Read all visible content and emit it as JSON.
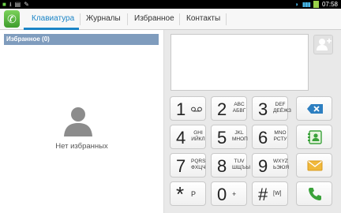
{
  "status_bar": {
    "time": "07:58"
  },
  "tabs": [
    {
      "label": "Клавиатура",
      "active": true
    },
    {
      "label": "Журналы",
      "active": false
    },
    {
      "label": "Избранное",
      "active": false
    },
    {
      "label": "Контакты",
      "active": false
    }
  ],
  "favorites": {
    "header": "Избранное (0)",
    "empty_text": "Нет избранных"
  },
  "keypad": {
    "keys": [
      {
        "digit": "1",
        "letters": "",
        "symbol": "voicemail"
      },
      {
        "digit": "2",
        "letters": "ABC\nАБВГ"
      },
      {
        "digit": "3",
        "letters": "DEF\nДЕЁЖЗ"
      },
      {
        "digit": "4",
        "letters": "GHI\nИЙКЛ"
      },
      {
        "digit": "5",
        "letters": "JKL\nМНОП"
      },
      {
        "digit": "6",
        "letters": "MNO\nРСТУ"
      },
      {
        "digit": "7",
        "letters": "PQRS\nФХЦЧ"
      },
      {
        "digit": "8",
        "letters": "TUV\nШЩЪЫ"
      },
      {
        "digit": "9",
        "letters": "WXYZ\nЬЭЮЯ"
      },
      {
        "digit": "*",
        "letters": "P"
      },
      {
        "digit": "0",
        "letters": "+"
      },
      {
        "digit": "#",
        "letters": "[W]"
      }
    ]
  },
  "icons": {
    "app": "phone-icon",
    "add_contact": "add-contact-icon",
    "backspace": "backspace-icon",
    "contact_card": "contact-card-icon",
    "message": "message-icon",
    "call": "call-icon"
  },
  "colors": {
    "accent": "#1a84c6",
    "favorites_header": "#7f9cbd",
    "backspace": "#2d7fc1",
    "call": "#3aa23a",
    "message": "#f0b83a"
  }
}
